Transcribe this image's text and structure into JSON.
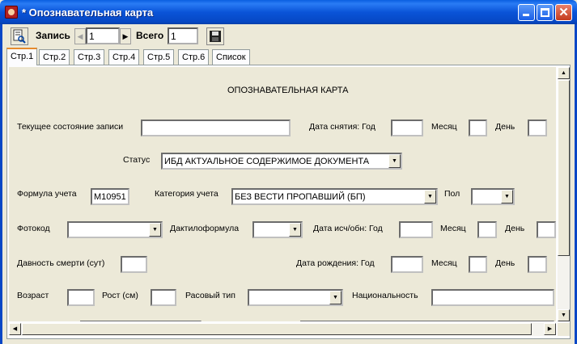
{
  "window": {
    "title": "* Опознавательная карта"
  },
  "toolbar": {
    "record_label": "Запись",
    "record_value": "1",
    "total_label": "Всего",
    "total_value": "1"
  },
  "tabs": [
    {
      "label": "Стр.1",
      "active": true
    },
    {
      "label": "Стр.2",
      "active": false
    },
    {
      "label": "Стр.3",
      "active": false
    },
    {
      "label": "Стр.4",
      "active": false
    },
    {
      "label": "Стр.5",
      "active": false
    },
    {
      "label": "Стр.6",
      "active": false
    },
    {
      "label": "Список",
      "active": false
    }
  ],
  "form": {
    "heading": "ОПОЗНАВАТЕЛЬНАЯ КАРТА",
    "current_state_label": "Текущее состояние записи",
    "current_state_value": "",
    "removal_date_label": "Дата снятия: Год",
    "month_label": "Месяц",
    "day_label": "День",
    "status_label": "Статус",
    "status_value": "ИБД АКТУАЛЬНОЕ СОДЕРЖИМОЕ ДОКУМЕНТА",
    "formula_label": "Формула учета",
    "formula_value": "М10951",
    "category_label": "Категория учета",
    "category_value": "БЕЗ ВЕСТИ ПРОПАВШИЙ (БП)",
    "sex_label": "Пол",
    "sex_value": "",
    "photocode_label": "Фотокод",
    "photocode_value": "",
    "dactylo_label": "Дактилоформула",
    "dactylo_value": "",
    "disappear_date_label": "Дата исч/обн: Год",
    "death_age_label": "Давность смерти (сут)",
    "birth_date_label": "Дата рождения: Год",
    "age_label": "Возраст",
    "height_label": "Рост (см)",
    "race_label": "Расовый тип",
    "race_value": "",
    "nationality_label": "Национальность",
    "nationality_value": ""
  },
  "colors": {
    "titlebar": "#0a54d8",
    "window_bg": "#ece9d8",
    "active_tab_accent": "#e68b2c"
  }
}
